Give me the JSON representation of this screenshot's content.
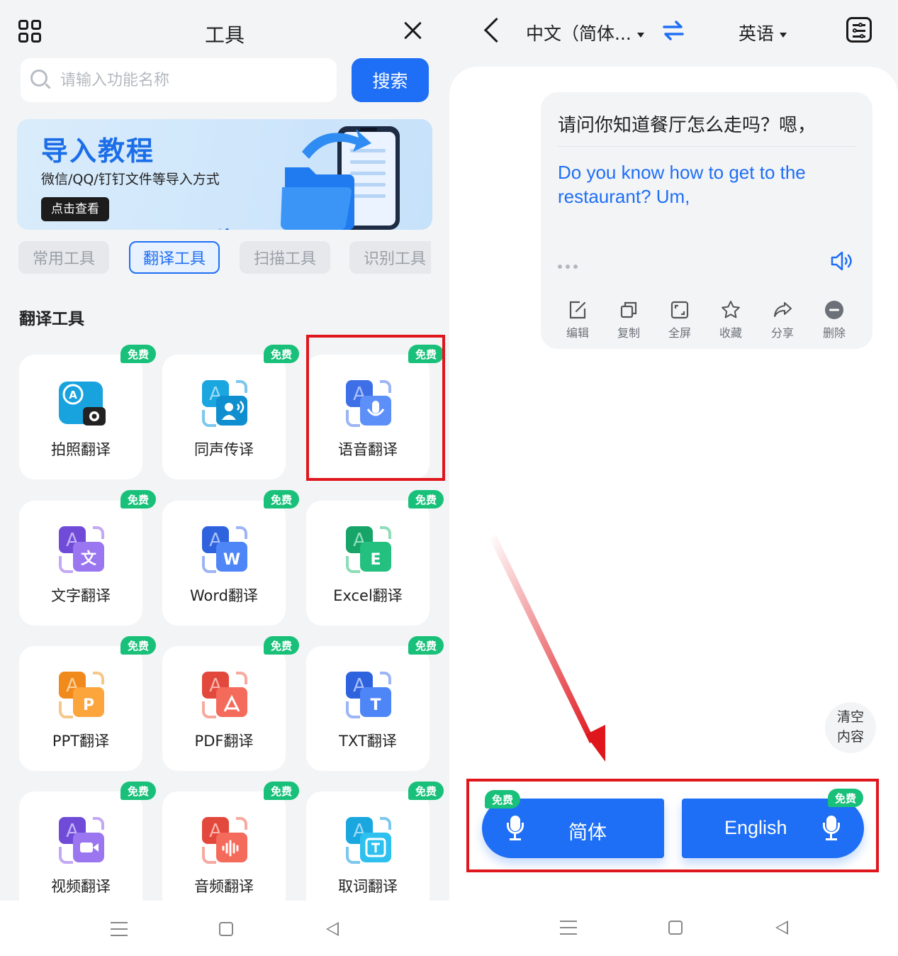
{
  "left": {
    "header": {
      "title": "工具",
      "grid_icon": "grid-icon",
      "close_icon": "close-icon"
    },
    "search": {
      "placeholder": "请输入功能名称",
      "button": "搜索"
    },
    "banner": {
      "title": "导入教程",
      "subtitle": "微信/QQ/钉钉文件等导入方式",
      "button": "点击查看",
      "active_slide": 2,
      "slide_count": 2
    },
    "tabs": [
      {
        "label": "常用工具",
        "active": false
      },
      {
        "label": "翻译工具",
        "active": true
      },
      {
        "label": "扫描工具",
        "active": false
      },
      {
        "label": "识别工具",
        "active": false
      }
    ],
    "section_title": "翻译工具",
    "badge": "免费",
    "tools": [
      {
        "label": "拍照翻译",
        "icon": "camera-translate-icon",
        "highlighted": false
      },
      {
        "label": "同声传译",
        "icon": "simultaneous-interpret-icon",
        "highlighted": false
      },
      {
        "label": "语音翻译",
        "icon": "voice-translate-icon",
        "highlighted": true
      },
      {
        "label": "文字翻译",
        "icon": "text-translate-icon",
        "highlighted": false
      },
      {
        "label": "Word翻译",
        "icon": "word-translate-icon",
        "highlighted": false
      },
      {
        "label": "Excel翻译",
        "icon": "excel-translate-icon",
        "highlighted": false
      },
      {
        "label": "PPT翻译",
        "icon": "ppt-translate-icon",
        "highlighted": false
      },
      {
        "label": "PDF翻译",
        "icon": "pdf-translate-icon",
        "highlighted": false
      },
      {
        "label": "TXT翻译",
        "icon": "txt-translate-icon",
        "highlighted": false
      },
      {
        "label": "视频翻译",
        "icon": "video-translate-icon",
        "highlighted": false
      },
      {
        "label": "音频翻译",
        "icon": "audio-translate-icon",
        "highlighted": false
      },
      {
        "label": "取词翻译",
        "icon": "word-pick-translate-icon",
        "highlighted": false
      }
    ]
  },
  "right": {
    "header": {
      "source_lang": "中文（简体...",
      "target_lang": "英语",
      "back_icon": "back-icon",
      "swap_icon": "swap-icon",
      "settings_icon": "settings-icon"
    },
    "card": {
      "source_text": "请问你知道餐厅怎么走吗？嗯，",
      "translated_text": "Do you know how to get to the restaurant? Um,",
      "actions": [
        {
          "label": "编辑",
          "icon": "edit-icon"
        },
        {
          "label": "复制",
          "icon": "copy-icon"
        },
        {
          "label": "全屏",
          "icon": "fullscreen-icon"
        },
        {
          "label": "收藏",
          "icon": "star-icon"
        },
        {
          "label": "分享",
          "icon": "share-icon"
        },
        {
          "label": "删除",
          "icon": "delete-icon"
        }
      ]
    },
    "clear_button": {
      "line1": "清空",
      "line2": "内容"
    },
    "mic_buttons": {
      "left_label": "简体",
      "right_label": "English",
      "badge": "免费"
    }
  },
  "colors": {
    "accent": "#1e6ff5",
    "badge": "#19c07a",
    "highlight": "#e0161d"
  }
}
